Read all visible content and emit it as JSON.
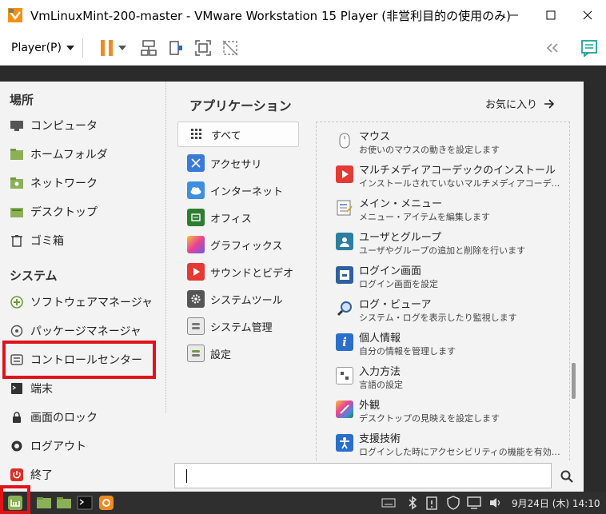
{
  "window": {
    "title": "VmLinuxMint-200-master - VMware Workstation 15 Player (非営利目的の使用のみ)"
  },
  "toolbar": {
    "player_menu": "Player(P)"
  },
  "places": {
    "heading": "場所",
    "items": [
      {
        "label": "コンピュータ"
      },
      {
        "label": "ホームフォルダ"
      },
      {
        "label": "ネットワーク"
      },
      {
        "label": "デスクトップ"
      },
      {
        "label": "ゴミ箱"
      }
    ]
  },
  "system": {
    "heading": "システム",
    "items": [
      {
        "label": "ソフトウェアマネージャ"
      },
      {
        "label": "パッケージマネージャ"
      },
      {
        "label": "コントロールセンター"
      },
      {
        "label": "端末"
      },
      {
        "label": "画面のロック"
      },
      {
        "label": "ログアウト"
      },
      {
        "label": "終了"
      }
    ]
  },
  "apps": {
    "heading": "アプリケーション",
    "favorites": "お気に入り",
    "categories": [
      {
        "label": "すべて"
      },
      {
        "label": "アクセサリ"
      },
      {
        "label": "インターネット"
      },
      {
        "label": "オフィス"
      },
      {
        "label": "グラフィックス"
      },
      {
        "label": "サウンドとビデオ"
      },
      {
        "label": "システムツール"
      },
      {
        "label": "システム管理"
      },
      {
        "label": "設定"
      }
    ],
    "list": [
      {
        "name": "マウス",
        "desc": "お使いのマウスの動きを設定します"
      },
      {
        "name": "マルチメディアコーデックのインストール",
        "desc": "インストールされていないマルチメディアコーデ..."
      },
      {
        "name": "メイン・メニュー",
        "desc": "メニュー・アイテムを編集します"
      },
      {
        "name": "ユーザとグループ",
        "desc": "ユーザやグループの追加と削除を行います"
      },
      {
        "name": "ログイン画面",
        "desc": "ログイン画面を設定"
      },
      {
        "name": "ログ・ビューア",
        "desc": "システム・ログを表示したり監視します"
      },
      {
        "name": "個人情報",
        "desc": "自分の情報を管理します"
      },
      {
        "name": "入力方法",
        "desc": "言語の設定"
      },
      {
        "name": "外観",
        "desc": "デスクトップの見映えを設定します"
      },
      {
        "name": "支援技術",
        "desc": "ログインした時にアクセシビリティの機能を有効に..."
      }
    ]
  },
  "search": {
    "value": ""
  },
  "taskbar": {
    "clock": "9月24日 (木) 14:10"
  },
  "colors": {
    "highlight_red": "#e0131b",
    "mint_green": "#8bb158",
    "pause_orange": "#f08a24"
  }
}
